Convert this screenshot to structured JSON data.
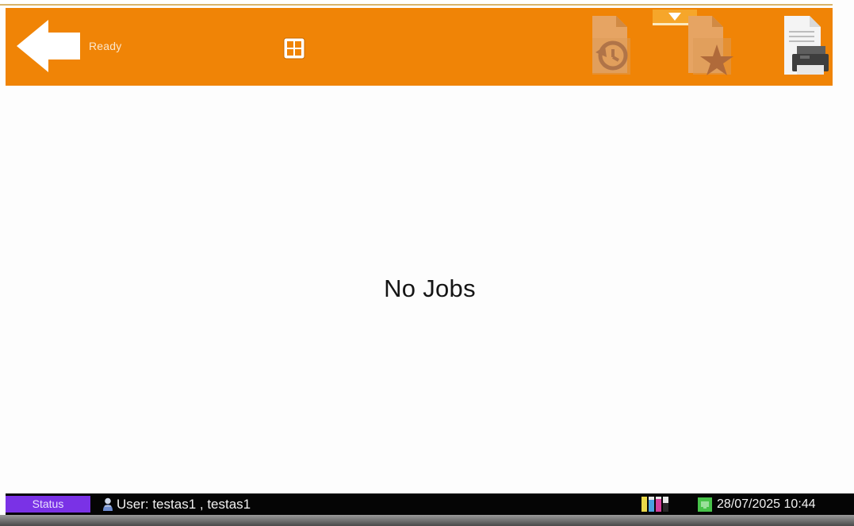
{
  "header": {
    "status_text": "Ready",
    "background_color": "#f08406",
    "back_icon": "back-arrow-icon",
    "grid_icon": "grid-icon",
    "tab_icon": "chevron-down-icon",
    "buttons": [
      {
        "name": "recent-jobs-button",
        "icon": "recent-jobs-icon"
      },
      {
        "name": "favorites-button",
        "icon": "favorites-star-icon"
      },
      {
        "name": "print-queue-button",
        "icon": "printer-icon"
      }
    ]
  },
  "main": {
    "empty_message": "No Jobs"
  },
  "statusbar": {
    "status_tab_label": "Status",
    "status_tab_color": "#7a32e6",
    "user_text": "User: testas1 , testas1",
    "datetime": "28/07/2025 10:44",
    "supplies_icon": "toner-levels-icon",
    "network_icon": "network-icon",
    "user_icon": "user-icon"
  }
}
